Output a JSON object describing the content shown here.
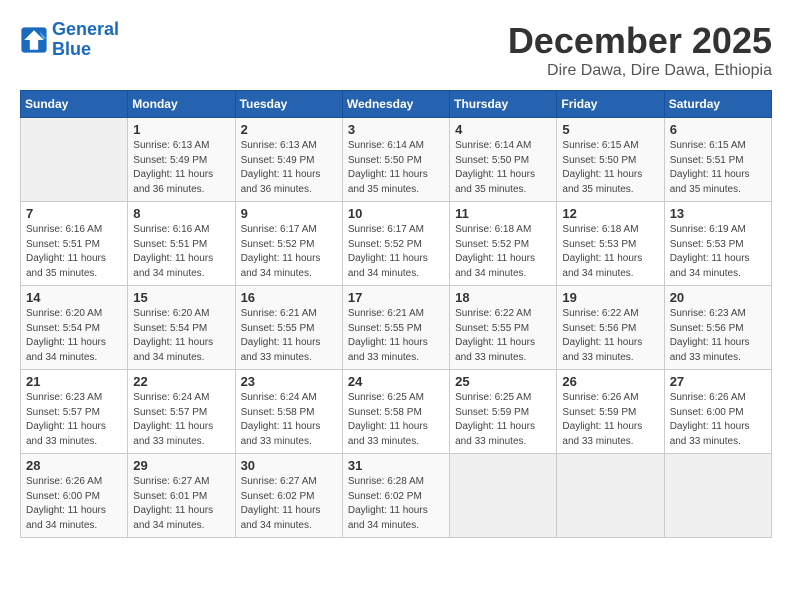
{
  "logo": {
    "text_general": "General",
    "text_blue": "Blue"
  },
  "title": "December 2025",
  "subtitle": "Dire Dawa, Dire Dawa, Ethiopia",
  "headers": [
    "Sunday",
    "Monday",
    "Tuesday",
    "Wednesday",
    "Thursday",
    "Friday",
    "Saturday"
  ],
  "weeks": [
    [
      {
        "day": "",
        "info": ""
      },
      {
        "day": "1",
        "info": "Sunrise: 6:13 AM\nSunset: 5:49 PM\nDaylight: 11 hours\nand 36 minutes."
      },
      {
        "day": "2",
        "info": "Sunrise: 6:13 AM\nSunset: 5:49 PM\nDaylight: 11 hours\nand 36 minutes."
      },
      {
        "day": "3",
        "info": "Sunrise: 6:14 AM\nSunset: 5:50 PM\nDaylight: 11 hours\nand 35 minutes."
      },
      {
        "day": "4",
        "info": "Sunrise: 6:14 AM\nSunset: 5:50 PM\nDaylight: 11 hours\nand 35 minutes."
      },
      {
        "day": "5",
        "info": "Sunrise: 6:15 AM\nSunset: 5:50 PM\nDaylight: 11 hours\nand 35 minutes."
      },
      {
        "day": "6",
        "info": "Sunrise: 6:15 AM\nSunset: 5:51 PM\nDaylight: 11 hours\nand 35 minutes."
      }
    ],
    [
      {
        "day": "7",
        "info": "Sunrise: 6:16 AM\nSunset: 5:51 PM\nDaylight: 11 hours\nand 35 minutes."
      },
      {
        "day": "8",
        "info": "Sunrise: 6:16 AM\nSunset: 5:51 PM\nDaylight: 11 hours\nand 34 minutes."
      },
      {
        "day": "9",
        "info": "Sunrise: 6:17 AM\nSunset: 5:52 PM\nDaylight: 11 hours\nand 34 minutes."
      },
      {
        "day": "10",
        "info": "Sunrise: 6:17 AM\nSunset: 5:52 PM\nDaylight: 11 hours\nand 34 minutes."
      },
      {
        "day": "11",
        "info": "Sunrise: 6:18 AM\nSunset: 5:52 PM\nDaylight: 11 hours\nand 34 minutes."
      },
      {
        "day": "12",
        "info": "Sunrise: 6:18 AM\nSunset: 5:53 PM\nDaylight: 11 hours\nand 34 minutes."
      },
      {
        "day": "13",
        "info": "Sunrise: 6:19 AM\nSunset: 5:53 PM\nDaylight: 11 hours\nand 34 minutes."
      }
    ],
    [
      {
        "day": "14",
        "info": "Sunrise: 6:20 AM\nSunset: 5:54 PM\nDaylight: 11 hours\nand 34 minutes."
      },
      {
        "day": "15",
        "info": "Sunrise: 6:20 AM\nSunset: 5:54 PM\nDaylight: 11 hours\nand 34 minutes."
      },
      {
        "day": "16",
        "info": "Sunrise: 6:21 AM\nSunset: 5:55 PM\nDaylight: 11 hours\nand 33 minutes."
      },
      {
        "day": "17",
        "info": "Sunrise: 6:21 AM\nSunset: 5:55 PM\nDaylight: 11 hours\nand 33 minutes."
      },
      {
        "day": "18",
        "info": "Sunrise: 6:22 AM\nSunset: 5:55 PM\nDaylight: 11 hours\nand 33 minutes."
      },
      {
        "day": "19",
        "info": "Sunrise: 6:22 AM\nSunset: 5:56 PM\nDaylight: 11 hours\nand 33 minutes."
      },
      {
        "day": "20",
        "info": "Sunrise: 6:23 AM\nSunset: 5:56 PM\nDaylight: 11 hours\nand 33 minutes."
      }
    ],
    [
      {
        "day": "21",
        "info": "Sunrise: 6:23 AM\nSunset: 5:57 PM\nDaylight: 11 hours\nand 33 minutes."
      },
      {
        "day": "22",
        "info": "Sunrise: 6:24 AM\nSunset: 5:57 PM\nDaylight: 11 hours\nand 33 minutes."
      },
      {
        "day": "23",
        "info": "Sunrise: 6:24 AM\nSunset: 5:58 PM\nDaylight: 11 hours\nand 33 minutes."
      },
      {
        "day": "24",
        "info": "Sunrise: 6:25 AM\nSunset: 5:58 PM\nDaylight: 11 hours\nand 33 minutes."
      },
      {
        "day": "25",
        "info": "Sunrise: 6:25 AM\nSunset: 5:59 PM\nDaylight: 11 hours\nand 33 minutes."
      },
      {
        "day": "26",
        "info": "Sunrise: 6:26 AM\nSunset: 5:59 PM\nDaylight: 11 hours\nand 33 minutes."
      },
      {
        "day": "27",
        "info": "Sunrise: 6:26 AM\nSunset: 6:00 PM\nDaylight: 11 hours\nand 33 minutes."
      }
    ],
    [
      {
        "day": "28",
        "info": "Sunrise: 6:26 AM\nSunset: 6:00 PM\nDaylight: 11 hours\nand 34 minutes."
      },
      {
        "day": "29",
        "info": "Sunrise: 6:27 AM\nSunset: 6:01 PM\nDaylight: 11 hours\nand 34 minutes."
      },
      {
        "day": "30",
        "info": "Sunrise: 6:27 AM\nSunset: 6:02 PM\nDaylight: 11 hours\nand 34 minutes."
      },
      {
        "day": "31",
        "info": "Sunrise: 6:28 AM\nSunset: 6:02 PM\nDaylight: 11 hours\nand 34 minutes."
      },
      {
        "day": "",
        "info": ""
      },
      {
        "day": "",
        "info": ""
      },
      {
        "day": "",
        "info": ""
      }
    ]
  ]
}
